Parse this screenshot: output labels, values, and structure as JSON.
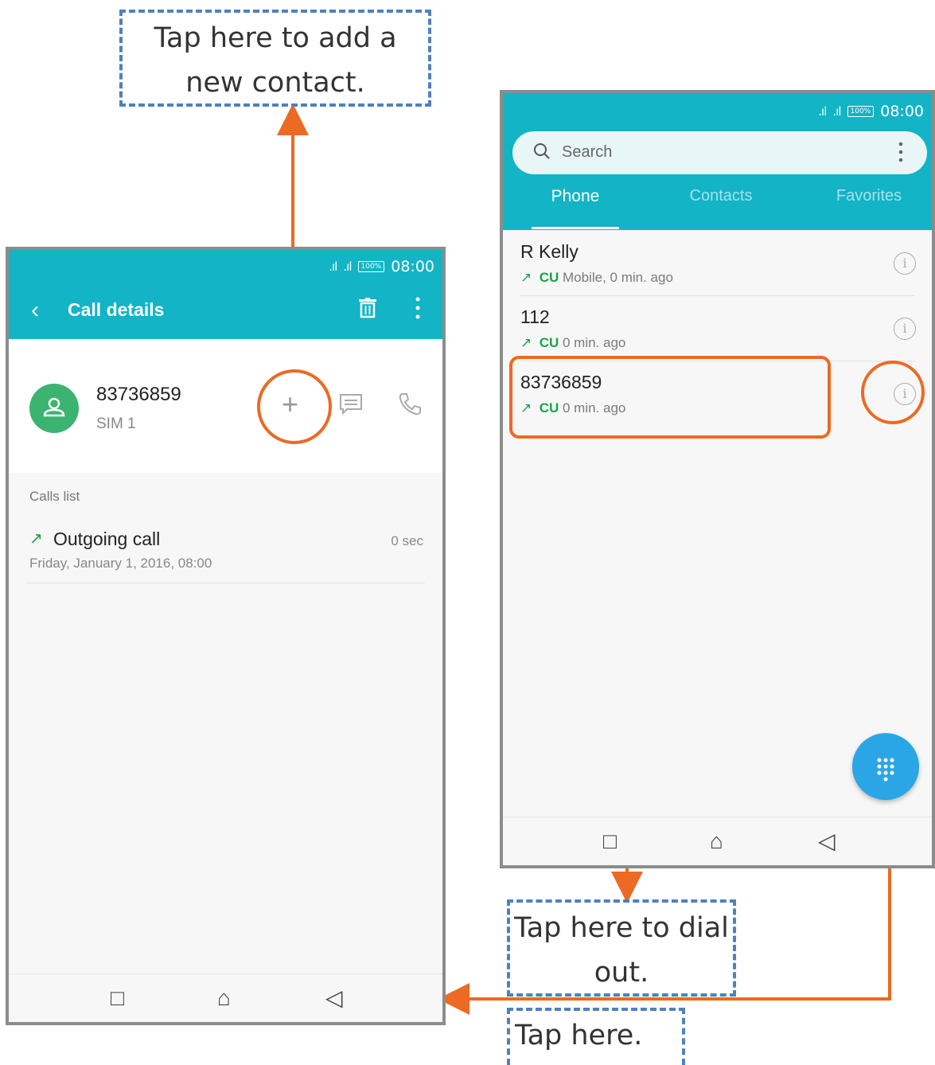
{
  "callouts": {
    "add_contact": "Tap here to add a new contact.",
    "dial_out": "Tap here to dial out.",
    "tap_here": "Tap here."
  },
  "left_phone": {
    "status": {
      "time": "08:00",
      "battery": "100%"
    },
    "header": {
      "title": "Call details"
    },
    "contact": {
      "number": "83736859",
      "sim": "SIM 1"
    },
    "calls_list_label": "Calls list",
    "call": {
      "type": "Outgoing call",
      "date": "Friday, January 1, 2016, 08:00",
      "duration": "0 sec"
    }
  },
  "right_phone": {
    "status": {
      "time": "08:00",
      "battery": "100%"
    },
    "search": {
      "placeholder": "Search"
    },
    "tabs": [
      {
        "label": "Phone",
        "active": true
      },
      {
        "label": "Contacts",
        "active": false
      },
      {
        "label": "Favorites",
        "active": false
      }
    ],
    "calls": [
      {
        "name": "R Kelly",
        "carrier": "CU",
        "detail": "Mobile, 0 min. ago"
      },
      {
        "name": "112",
        "carrier": "CU",
        "detail": "0 min. ago"
      },
      {
        "name": "83736859",
        "carrier": "CU",
        "detail": "0 min. ago"
      }
    ]
  },
  "colors": {
    "accent": "#12b4c6",
    "highlight": "#ec6a23",
    "callout_border": "#4f81bd",
    "fab": "#2aa6e6",
    "avatar": "#3cb371"
  },
  "icons": [
    "back-icon",
    "trash-icon",
    "more-icon",
    "add-icon",
    "message-icon",
    "phone-icon",
    "search-icon",
    "info-icon",
    "dialpad-icon",
    "recent-apps-icon",
    "home-icon",
    "back-nav-icon"
  ]
}
